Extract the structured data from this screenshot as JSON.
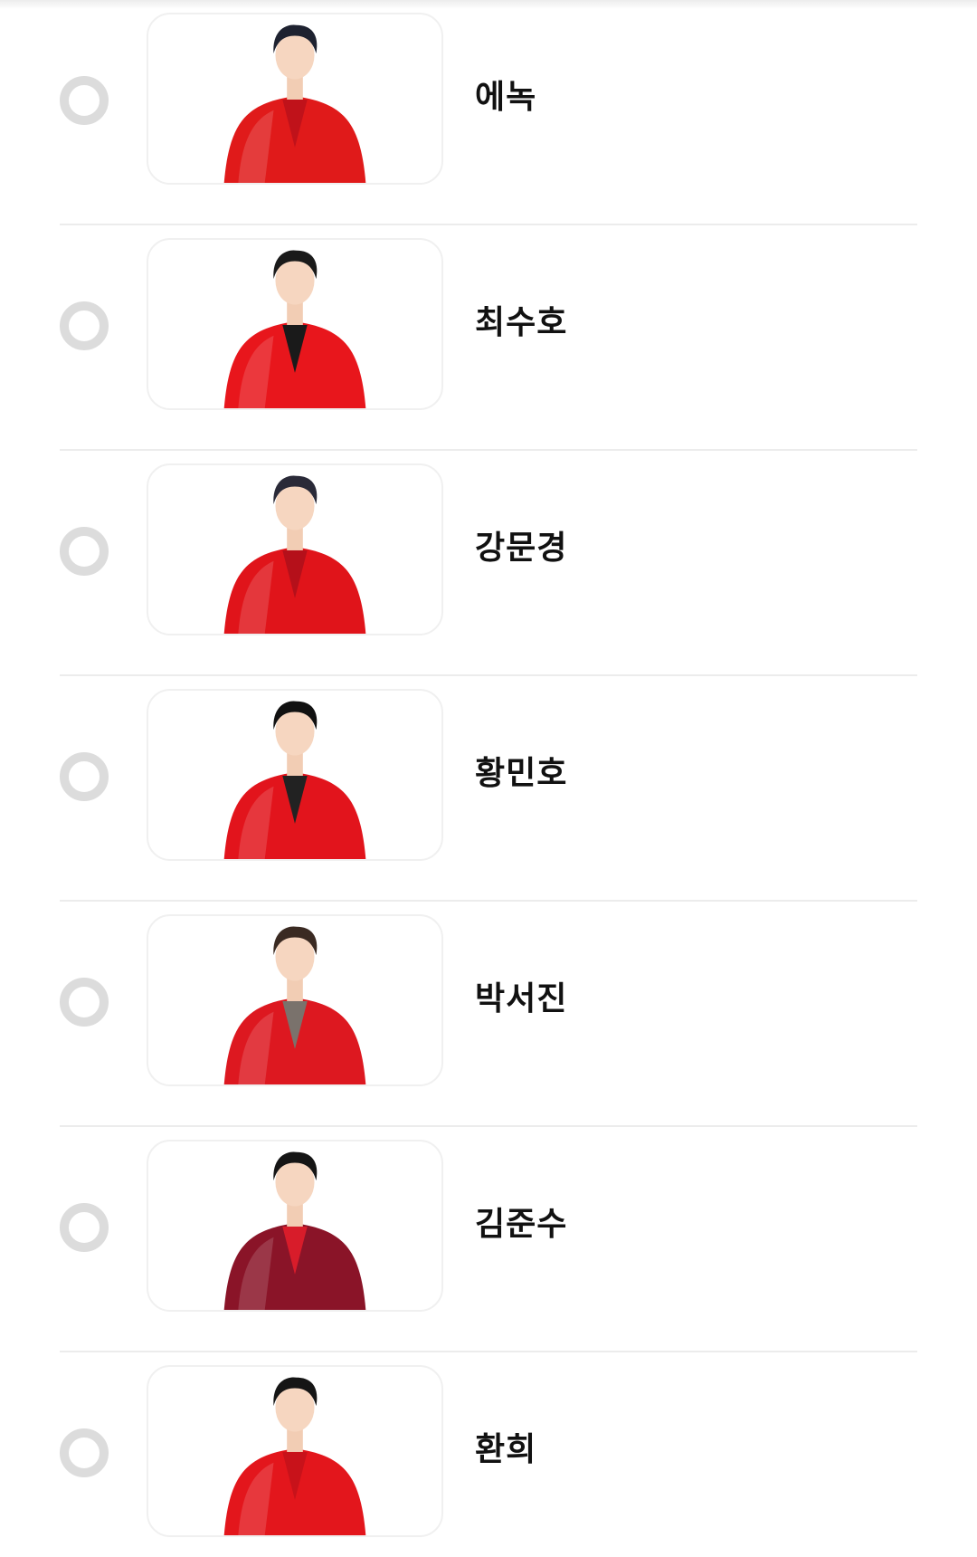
{
  "candidates": [
    {
      "name": "에녹",
      "photo": "portrait-photo",
      "selected": false,
      "outfit_color": "#e01a1a",
      "inner_color": "#c0121a",
      "hair_color": "#1e2230"
    },
    {
      "name": "최수호",
      "photo": "portrait-photo",
      "selected": false,
      "outfit_color": "#e8161c",
      "inner_color": "#1a1a1a",
      "hair_color": "#1a1a1a"
    },
    {
      "name": "강문경",
      "photo": "portrait-photo",
      "selected": false,
      "outfit_color": "#e0141a",
      "inner_color": "#b5101a",
      "hair_color": "#2a2a38"
    },
    {
      "name": "황민호",
      "photo": "portrait-photo",
      "selected": false,
      "outfit_color": "#e2141c",
      "inner_color": "#222222",
      "hair_color": "#111111"
    },
    {
      "name": "박서진",
      "photo": "portrait-photo",
      "selected": false,
      "outfit_color": "#dd1820",
      "inner_color": "#7a726c",
      "hair_color": "#3a2a22"
    },
    {
      "name": "김준수",
      "photo": "portrait-photo",
      "selected": false,
      "outfit_color": "#8a1428",
      "inner_color": "#d81c2a",
      "hair_color": "#151515"
    },
    {
      "name": "환희",
      "photo": "portrait-photo",
      "selected": false,
      "outfit_color": "#e3161c",
      "inner_color": "#c8121a",
      "hair_color": "#151515"
    }
  ]
}
